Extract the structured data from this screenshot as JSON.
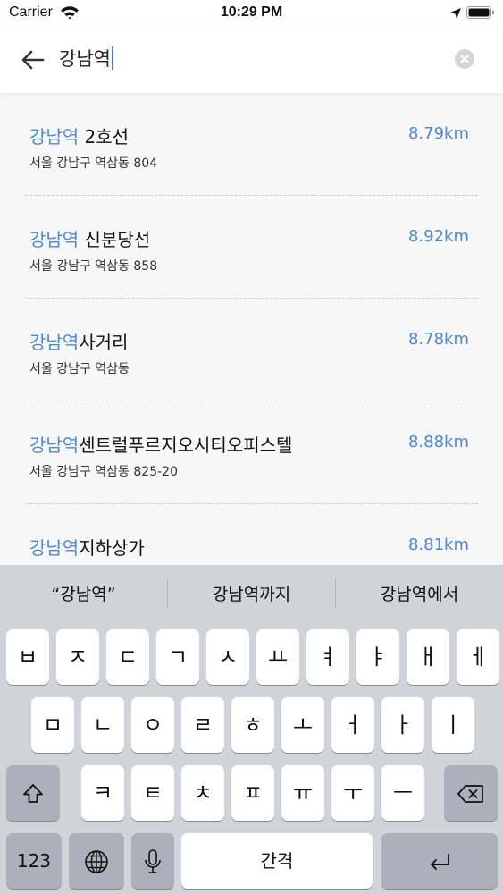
{
  "status_bar": {
    "carrier": "Carrier",
    "time": "10:29 PM",
    "icons": [
      "wifi-icon",
      "location-arrow-icon",
      "battery-icon"
    ]
  },
  "search": {
    "query": "강남역",
    "icons": [
      "arrow-left-icon",
      "clear-icon"
    ]
  },
  "results": [
    {
      "highlight": "강남역",
      "rest": " 2호선",
      "address": "서울 강남구 역삼동 804",
      "distance": "8.79km"
    },
    {
      "highlight": "강남역",
      "rest": " 신분당선",
      "address": "서울 강남구 역삼동 858",
      "distance": "8.92km"
    },
    {
      "highlight": "강남역",
      "rest": "사거리",
      "address": "서울 강남구 역삼동",
      "distance": "8.78km"
    },
    {
      "highlight": "강남역",
      "rest": "센트럴푸르지오시티오피스텔",
      "address": "서울 강남구 역삼동 825-20",
      "distance": "8.88km"
    },
    {
      "highlight": "강남역",
      "rest": "지하상가",
      "address": "",
      "distance": "8.81km"
    }
  ],
  "keyboard": {
    "suggestions": [
      "“강남역”",
      "강남역까지",
      "강남역에서"
    ],
    "row1": [
      "ㅂ",
      "ㅈ",
      "ㄷ",
      "ㄱ",
      "ㅅ",
      "ㅛ",
      "ㅕ",
      "ㅑ",
      "ㅐ",
      "ㅔ"
    ],
    "row2": [
      "ㅁ",
      "ㄴ",
      "ㅇ",
      "ㄹ",
      "ㅎ",
      "ㅗ",
      "ㅓ",
      "ㅏ",
      "ㅣ"
    ],
    "row3": [
      "ㅋ",
      "ㅌ",
      "ㅊ",
      "ㅍ",
      "ㅠ",
      "ㅜ",
      "ㅡ"
    ],
    "numbers_label": "123",
    "space_label": "간격",
    "icons": [
      "shift-icon",
      "backspace-icon",
      "globe-icon",
      "microphone-icon",
      "return-icon"
    ]
  }
}
